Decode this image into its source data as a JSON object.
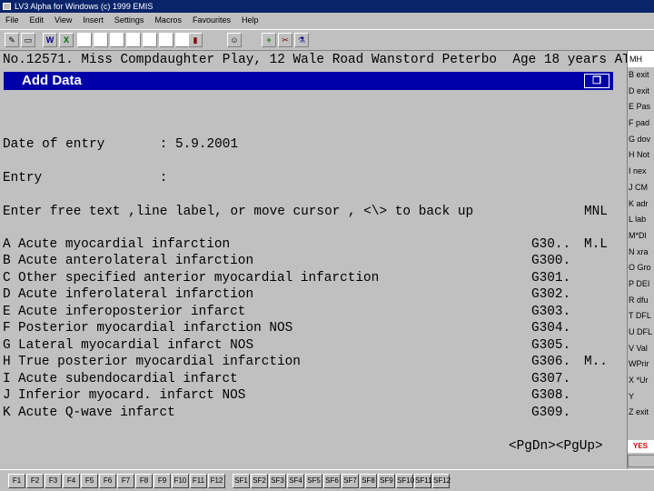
{
  "window": {
    "title": "LV3 Alpha for Windows (c) 1999 EMIS"
  },
  "menu": [
    "File",
    "Edit",
    "View",
    "Insert",
    "Settings",
    "Macros",
    "Favourites",
    "Help"
  ],
  "toolbar": {
    "icons": [
      "edit-icon",
      "folder-icon",
      "word-icon",
      "excel-icon",
      "book-icon",
      "person-icon",
      "add-icon",
      "tools-icon",
      "flask-icon"
    ]
  },
  "terminal": {
    "patient": "No.12571. Miss Compdaughter Play, 12 Wale Road Wanstord Peterbo  Age 18 years AT",
    "banner": "Add Data",
    "date_line": "Date of entry       : 5.9.2001",
    "entry_line": "Entry               :",
    "prompt_line": "Enter free text ,line label, or move cursor , <\\> to back up",
    "prompt_right": "MNL",
    "rows": [
      {
        "key": "A",
        "text": "Acute myocardial infarction",
        "code": "G30..",
        "flag": "M.L"
      },
      {
        "key": "B",
        "text": "Acute anterolateral infarction",
        "code": "G300.",
        "flag": ""
      },
      {
        "key": "C",
        "text": "Other specified anterior myocardial infarction",
        "code": "G301.",
        "flag": ""
      },
      {
        "key": "D",
        "text": "Acute inferolateral infarction",
        "code": "G302.",
        "flag": ""
      },
      {
        "key": "E",
        "text": "Acute inferoposterior infarct",
        "code": "G303.",
        "flag": ""
      },
      {
        "key": "F",
        "text": "Posterior myocardial infarction NOS",
        "code": "G304.",
        "flag": ""
      },
      {
        "key": "G",
        "text": "Lateral myocardial infarct NOS",
        "code": "G305.",
        "flag": ""
      },
      {
        "key": "H",
        "text": "True posterior myocardial infarction",
        "code": "G306.",
        "flag": "M.."
      },
      {
        "key": "I",
        "text": "Acute subendocardial infarct",
        "code": "G307.",
        "flag": ""
      },
      {
        "key": "J",
        "text": "Inferior myocard. infarct NOS",
        "code": "G308.",
        "flag": ""
      },
      {
        "key": "K",
        "text": "Acute Q-wave infarct",
        "code": "G309.",
        "flag": ""
      }
    ],
    "paging": "<PgDn><PgUp>"
  },
  "right_panel": {
    "header": "MH",
    "items": [
      "B exit",
      "D exit",
      "E Pas",
      "F pad",
      "G dov",
      "H Not",
      "I nex",
      "J CM",
      "K adr",
      "L lab",
      "M*Dl",
      "N xra",
      "O Gro",
      "P DEI",
      "R dfu",
      "T DFL",
      "U DFL",
      "V Val",
      "WPrir",
      "X *Ur",
      "Y",
      "Z exit"
    ],
    "yes": "YES"
  },
  "fkeys": [
    "F1",
    "F2",
    "F3",
    "F4",
    "F5",
    "F6",
    "F7",
    "F8",
    "F9",
    "F10",
    "F11",
    "F12",
    "SF1",
    "SF2",
    "SF3",
    "SF4",
    "SF5",
    "SF6",
    "SF7",
    "SF8",
    "SF9",
    "SF10",
    "SF11",
    "SF12"
  ]
}
